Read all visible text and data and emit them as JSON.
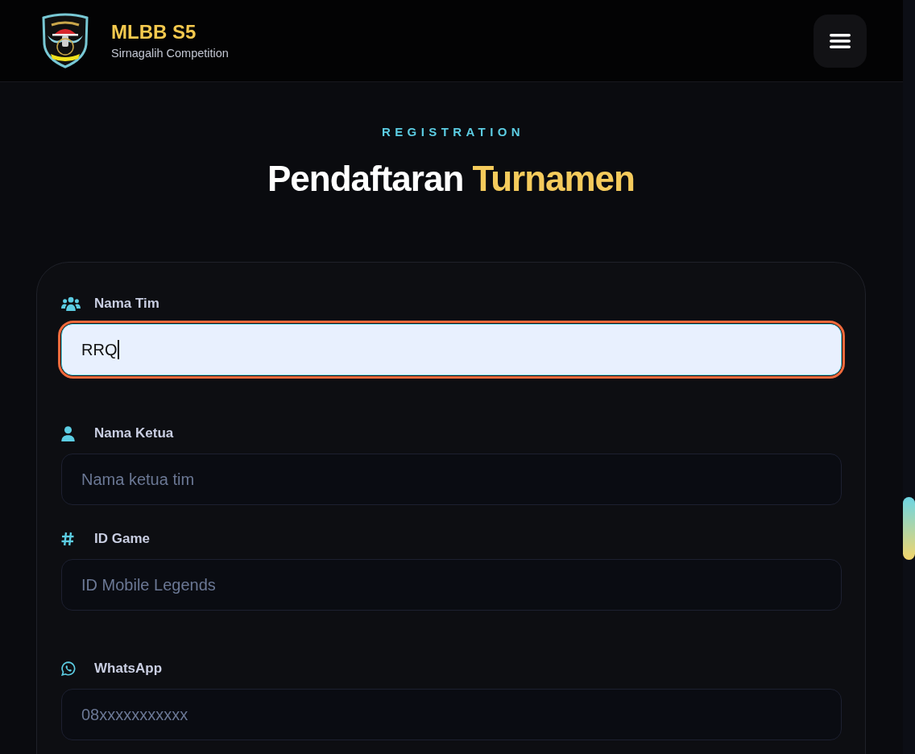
{
  "header": {
    "title": "MLBB S5",
    "subtitle": "Sirnagalih Competition"
  },
  "section": {
    "eyebrow": "REGISTRATION",
    "title": "Pendaftaran",
    "title_accent": "Turnamen"
  },
  "form": {
    "groups": [
      {
        "fields": [
          {
            "kind": "team",
            "label": "Nama Tim",
            "value": "RRQ",
            "focused": true
          }
        ]
      },
      {
        "fields": [
          {
            "kind": "person",
            "label": "Nama Ketua",
            "placeholder": "Nama ketua tim",
            "focused": false
          },
          {
            "kind": "id",
            "label": "ID Game",
            "placeholder": "ID Mobile Legends",
            "focused": false
          }
        ]
      },
      {
        "fields": [
          {
            "kind": "phone",
            "label": "WhatsApp",
            "placeholder": "08xxxxxxxxxxx",
            "focused": false
          }
        ]
      }
    ]
  }
}
